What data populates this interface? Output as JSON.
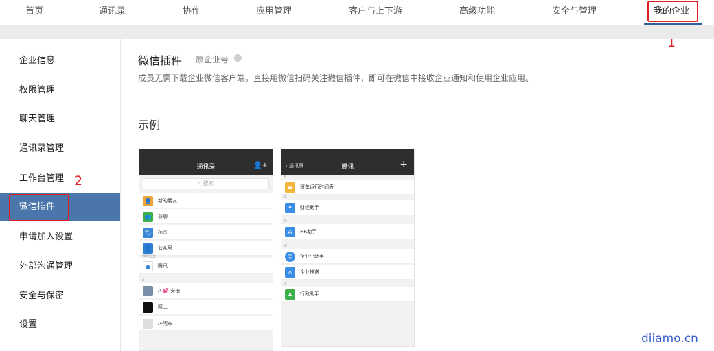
{
  "topnav": {
    "items": [
      "首页",
      "通讯录",
      "协作",
      "应用管理",
      "客户与上下游",
      "高级功能",
      "安全与管理",
      "我的企业"
    ]
  },
  "annotations": {
    "one": "1",
    "two": "2"
  },
  "sidebar": {
    "items": [
      "企业信息",
      "权限管理",
      "聊天管理",
      "通讯录管理",
      "工作台管理",
      "微信插件",
      "申请加入设置",
      "外部沟通管理",
      "安全与保密",
      "设置"
    ]
  },
  "main": {
    "title": "微信插件",
    "subtitle": "原企业号",
    "info_icon": "i",
    "description": "成员无需下载企业微信客户端，直接用微信扫码关注微信插件，即可在微信中接收企业通知和使用企业应用。",
    "example_label": "示例"
  },
  "phone1": {
    "title": "通讯录",
    "add_icon": "👤+",
    "search_placeholder": "搜索",
    "rows": [
      "新的朋友",
      "群聊",
      "标签",
      "公众号"
    ],
    "section_my": "我的企业",
    "company": "腾讯",
    "section_a": "A",
    "contacts": [
      "A 💕 安柏",
      "阿土",
      "A-阿布"
    ]
  },
  "phone2": {
    "back": "通讯录",
    "title": "腾讯",
    "plus": "+",
    "sections": [
      "B",
      "C",
      "H",
      "Q",
      "X"
    ],
    "rows": [
      "班车运行时间表",
      "财经助手",
      "HR助手",
      "企业小助手",
      "企业推送",
      "行政助手"
    ]
  },
  "watermark": "diiamo.cn"
}
